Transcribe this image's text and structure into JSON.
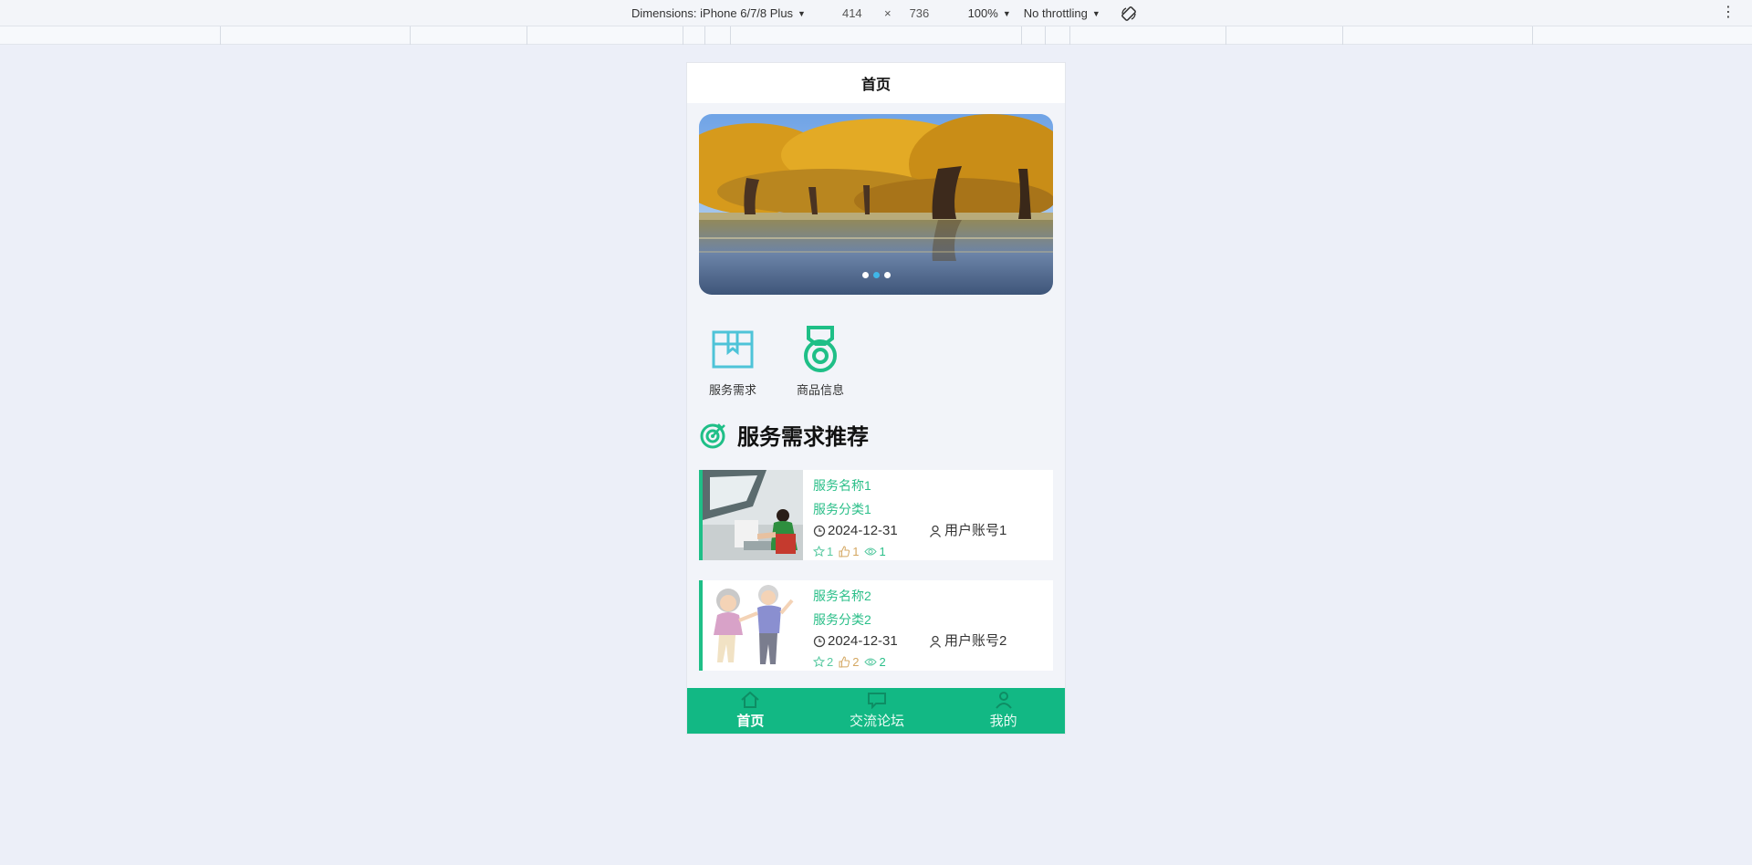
{
  "devtools": {
    "dimensions_label": "Dimensions: iPhone 6/7/8 Plus",
    "width": "414",
    "times": "×",
    "height": "736",
    "zoom": "100%",
    "throttle": "No throttling",
    "more_icon": "⋮"
  },
  "page": {
    "title": "首页",
    "banner": {
      "dots": 3,
      "active_dot": 1
    },
    "categories": [
      {
        "label": "服务需求",
        "icon": "box-icon",
        "color": "#4ec3d8"
      },
      {
        "label": "商品信息",
        "icon": "medal-icon",
        "color": "#1fbf87"
      }
    ],
    "section_title": "服务需求推荐",
    "items": [
      {
        "name": "服务名称1",
        "type": "服务分类1",
        "date": "2024-12-31",
        "user": "用户账号1",
        "favs": "1",
        "likes": "1",
        "views": "1"
      },
      {
        "name": "服务名称2",
        "type": "服务分类2",
        "date": "2024-12-31",
        "user": "用户账号2",
        "favs": "2",
        "likes": "2",
        "views": "2"
      }
    ],
    "tabs": [
      {
        "label": "首页",
        "icon": "home-icon",
        "active": true
      },
      {
        "label": "交流论坛",
        "icon": "forum-icon",
        "active": false
      },
      {
        "label": "我的",
        "icon": "user-icon",
        "active": false
      }
    ]
  },
  "colors": {
    "accent": "#1fbf87",
    "tabbar": "#12b884",
    "background": "#eceff8"
  }
}
